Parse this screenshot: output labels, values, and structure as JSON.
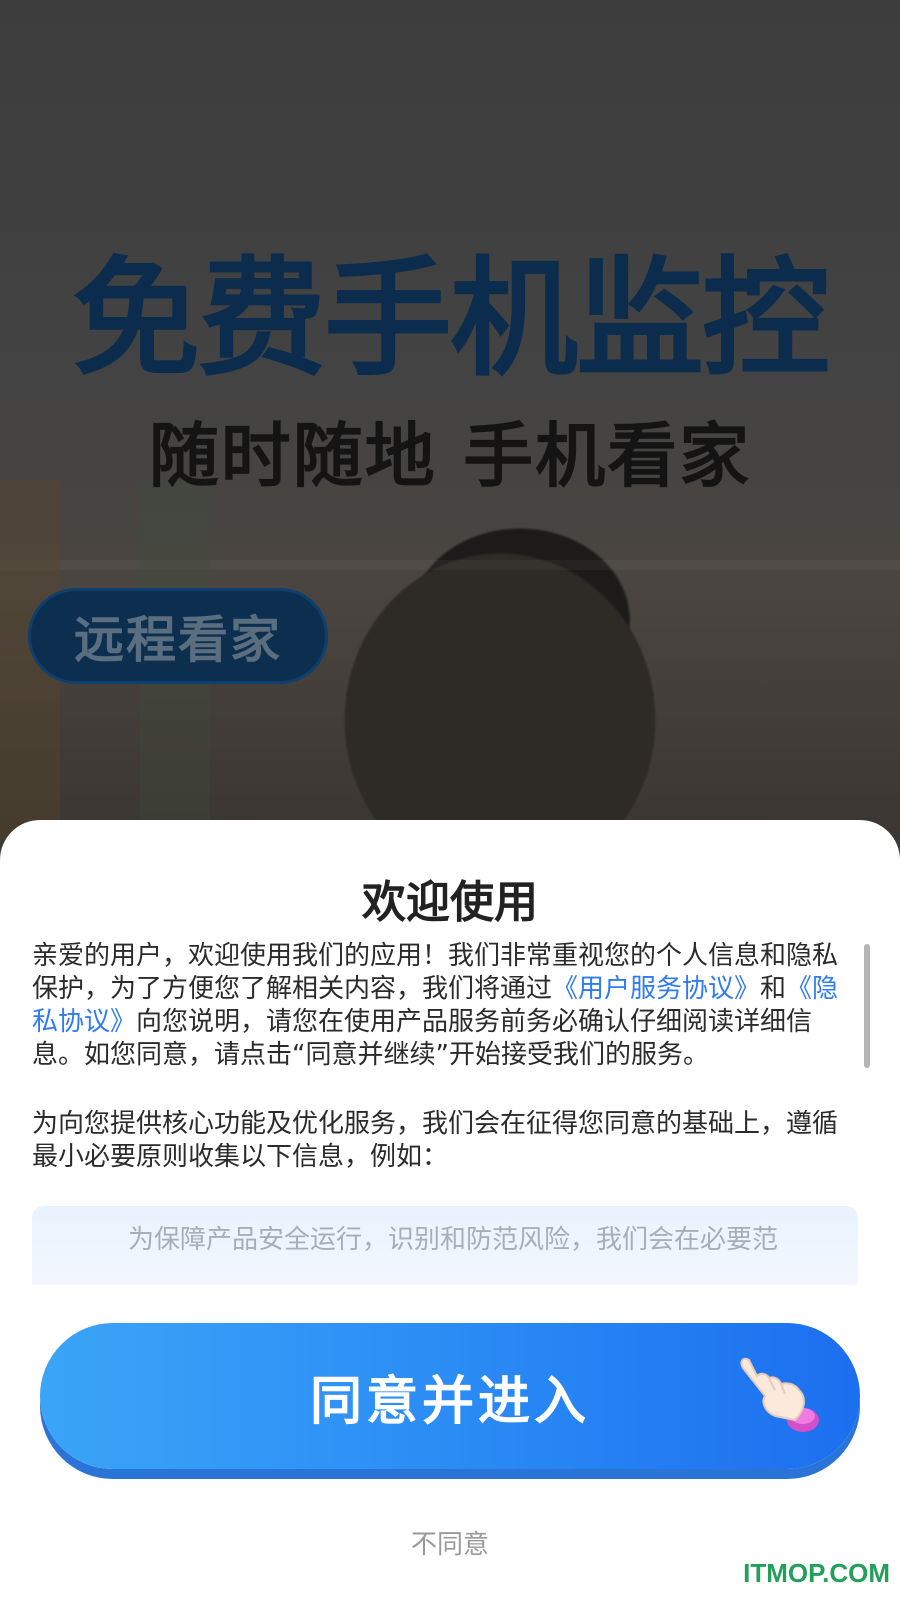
{
  "hero": {
    "title": "免费手机监控",
    "subtitle": "随时随地 手机看家",
    "badge": "远程看家"
  },
  "dialog": {
    "title": "欢迎使用",
    "para1": [
      {
        "text": "亲爱的用户，欢迎使用我们的应用！我们非常重视您的个人信息和隐私保护，为了方便您了解相关内容，我们将通过"
      },
      {
        "text": "《用户服务协议》",
        "link": true
      },
      {
        "text": "和"
      },
      {
        "text": "《隐私协议》",
        "link": true
      },
      {
        "text": "向您说明，请您在使用产品服务前务必确认仔细阅读详细信息。如您同意，请点击“同意并继续”开始接受我们的服务。"
      }
    ],
    "para2": "为向您提供核心功能及优化服务，我们会在征得您同意的基础上，遵循最小必要原则收集以下信息，例如：",
    "info_box_text": "为保障产品安全运行，识别和防范风险，我们会在必要范",
    "agree_label": "同意并进入",
    "disagree_label": "不同意"
  },
  "watermark": "ITMOP.COM",
  "colors": {
    "accent": "#2b8cf5",
    "link": "#2f7bf5",
    "hero_title": "#0b2c4d"
  },
  "icons": {
    "agree_button": "pointing-hand-icon"
  }
}
